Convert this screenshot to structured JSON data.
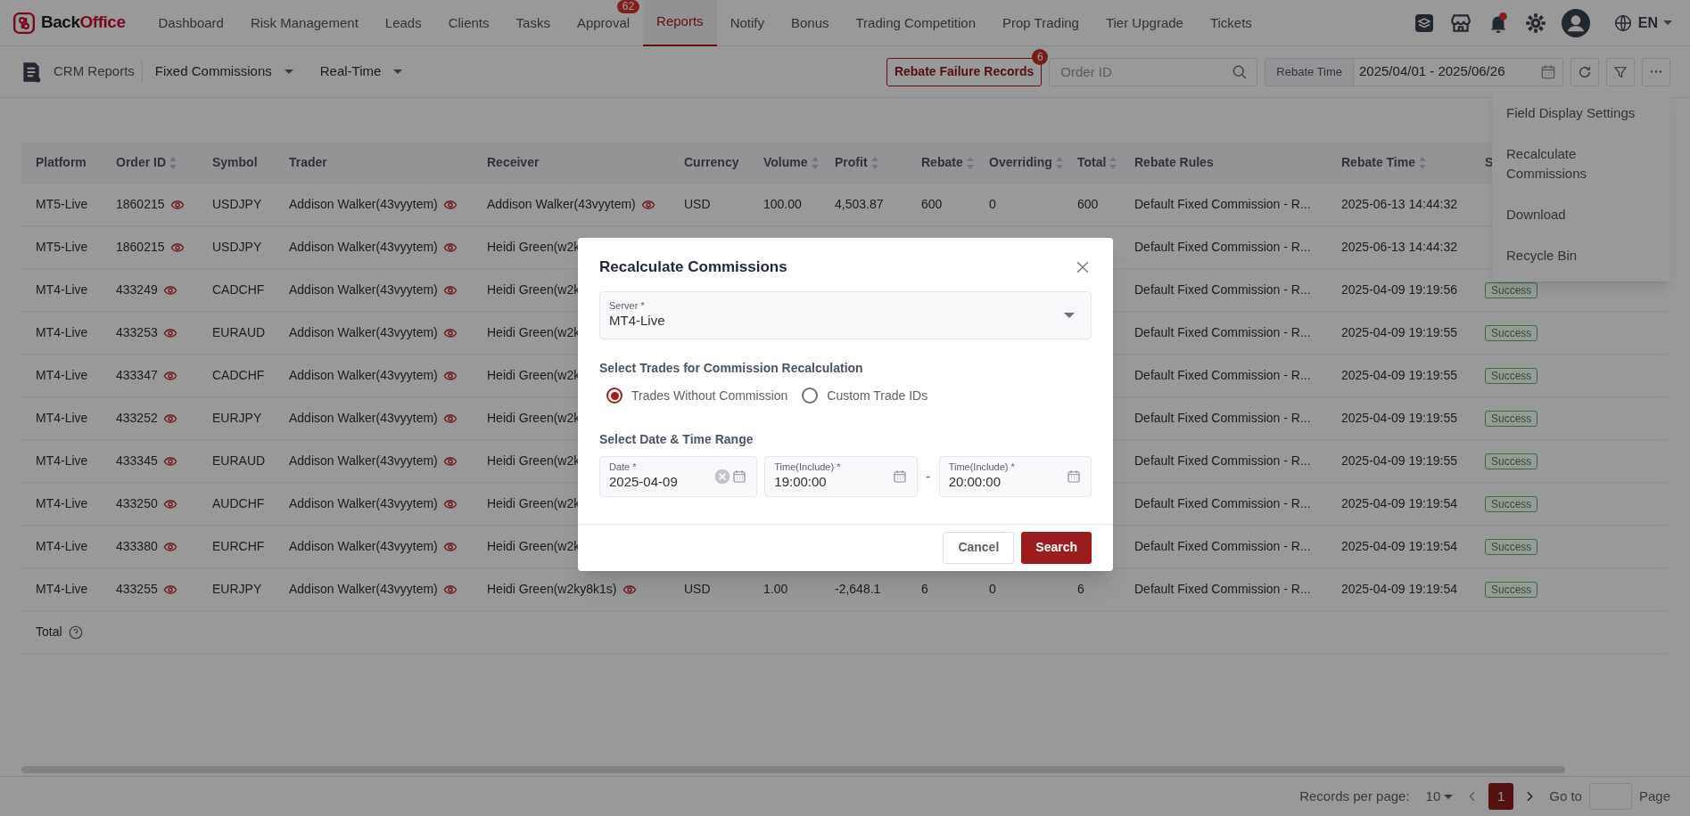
{
  "nav": {
    "logo": {
      "dark": "Back",
      "accent": "Office"
    },
    "items": [
      {
        "label": "Dashboard",
        "selected": false
      },
      {
        "label": "Risk Management",
        "selected": false
      },
      {
        "label": "Leads",
        "selected": false
      },
      {
        "label": "Clients",
        "selected": false
      },
      {
        "label": "Tasks",
        "selected": false
      },
      {
        "label": "Approval",
        "selected": false,
        "badge": "62"
      },
      {
        "label": "Reports",
        "selected": true
      },
      {
        "label": "Notify",
        "selected": false
      },
      {
        "label": "Bonus",
        "selected": false
      },
      {
        "label": "Trading Competition",
        "selected": false
      },
      {
        "label": "Prop Trading",
        "selected": false
      },
      {
        "label": "Tier Upgrade",
        "selected": false
      },
      {
        "label": "Tickets",
        "selected": false
      }
    ],
    "language": "EN"
  },
  "toolbar": {
    "title": "CRM Reports",
    "dropdowns": [
      "Fixed Commissions",
      "Real-Time"
    ],
    "failure_button": {
      "label": "Rebate Failure Records",
      "badge": "6"
    },
    "search": {
      "placeholder": "Order ID"
    },
    "date_filter": {
      "label": "Rebate Time",
      "value": "2025/04/01 - 2025/06/26"
    }
  },
  "menu": {
    "items": [
      "Field Display Settings",
      "Recalculate Commissions",
      "Download",
      "Recycle Bin"
    ]
  },
  "table": {
    "columns": [
      {
        "label": "Platform",
        "sortable": false
      },
      {
        "label": "Order ID",
        "sortable": true
      },
      {
        "label": "Symbol",
        "sortable": false
      },
      {
        "label": "Trader",
        "sortable": false
      },
      {
        "label": "Receiver",
        "sortable": false
      },
      {
        "label": "Currency",
        "sortable": false
      },
      {
        "label": "Volume",
        "sortable": true
      },
      {
        "label": "Profit",
        "sortable": true
      },
      {
        "label": "Rebate",
        "sortable": true
      },
      {
        "label": "Overriding",
        "sortable": true
      },
      {
        "label": "Total",
        "sortable": true
      },
      {
        "label": "Rebate Rules",
        "sortable": false
      },
      {
        "label": "Rebate Time",
        "sortable": true
      },
      {
        "label": "S",
        "sortable": false
      }
    ],
    "rows": [
      {
        "platform": "MT5-Live",
        "order_id": "1860215",
        "symbol": "USDJPY",
        "trader": "Addison Walker(43vyytem)",
        "receiver": "Addison Walker(43vyytem)",
        "currency": "USD",
        "volume": "100.00",
        "profit": "4,503.87",
        "rebate": "600",
        "overriding": "0",
        "total": "600",
        "rebate_rule": "Default Fixed Commission - R...",
        "rebate_time": "2025-06-13 14:44:32"
      },
      {
        "platform": "MT5-Live",
        "order_id": "1860215",
        "symbol": "USDJPY",
        "trader": "Addison Walker(43vyytem)",
        "receiver": "Heidi Green(w2k",
        "rebate_rule": "Default Fixed Commission - R...",
        "rebate_time": "2025-06-13 14:44:32"
      },
      {
        "platform": "MT4-Live",
        "order_id": "433249",
        "symbol": "CADCHF",
        "trader": "Addison Walker(43vyytem)",
        "receiver": "Heidi Green(w2k",
        "rebate_rule": "Default Fixed Commission - R...",
        "rebate_time": "2025-04-09 19:19:56",
        "status": "Success"
      },
      {
        "platform": "MT4-Live",
        "order_id": "433253",
        "symbol": "EURAUD",
        "trader": "Addison Walker(43vyytem)",
        "receiver": "Heidi Green(w2k",
        "rebate_rule": "Default Fixed Commission - R...",
        "rebate_time": "2025-04-09 19:19:55",
        "status": "Success"
      },
      {
        "platform": "MT4-Live",
        "order_id": "433347",
        "symbol": "CADCHF",
        "trader": "Addison Walker(43vyytem)",
        "receiver": "Heidi Green(w2k",
        "rebate_rule": "Default Fixed Commission - R...",
        "rebate_time": "2025-04-09 19:19:55",
        "status": "Success"
      },
      {
        "platform": "MT4-Live",
        "order_id": "433252",
        "symbol": "EURJPY",
        "trader": "Addison Walker(43vyytem)",
        "receiver": "Heidi Green(w2k",
        "rebate_rule": "Default Fixed Commission - R...",
        "rebate_time": "2025-04-09 19:19:55",
        "status": "Success"
      },
      {
        "platform": "MT4-Live",
        "order_id": "433345",
        "symbol": "EURAUD",
        "trader": "Addison Walker(43vyytem)",
        "receiver": "Heidi Green(w2k",
        "rebate_rule": "Default Fixed Commission - R...",
        "rebate_time": "2025-04-09 19:19:55",
        "status": "Success"
      },
      {
        "platform": "MT4-Live",
        "order_id": "433250",
        "symbol": "AUDCHF",
        "trader": "Addison Walker(43vyytem)",
        "receiver": "Heidi Green(w2k",
        "rebate_rule": "Default Fixed Commission - R...",
        "rebate_time": "2025-04-09 19:19:54",
        "status": "Success"
      },
      {
        "platform": "MT4-Live",
        "order_id": "433380",
        "symbol": "EURCHF",
        "trader": "Addison Walker(43vyytem)",
        "receiver": "Heidi Green(w2k",
        "rebate_rule": "Default Fixed Commission - R...",
        "rebate_time": "2025-04-09 19:19:54",
        "status": "Success"
      },
      {
        "platform": "MT4-Live",
        "order_id": "433255",
        "symbol": "EURJPY",
        "trader": "Addison Walker(43vyytem)",
        "receiver": "Heidi Green(w2ky8k1s)",
        "currency": "USD",
        "volume": "1.00",
        "profit": "-2,648.1",
        "rebate": "6",
        "overriding": "0",
        "total": "6",
        "rebate_rule": "Default Fixed Commission - R...",
        "rebate_time": "2025-04-09 19:19:54",
        "status": "Success"
      }
    ],
    "footer": "Total"
  },
  "pagination": {
    "label": "Records per page:",
    "per_page": "10",
    "pages": [
      {
        "label": "1",
        "selected": true
      }
    ],
    "goto": "Go to",
    "page_suffix": "Page"
  },
  "dialog": {
    "title": "Recalculate Commissions",
    "server": {
      "label": "Server *",
      "value": "MT4-Live"
    },
    "trades_heading": "Select Trades for Commission Recalculation",
    "options": [
      {
        "label": "Trades Without Commission",
        "selected": true
      },
      {
        "label": "Custom Trade IDs",
        "selected": false
      }
    ],
    "range_heading": "Select Date & Time Range",
    "date": {
      "label": "Date *",
      "value": "2025-04-09"
    },
    "time_from": {
      "label": "Time(Include) *",
      "value": "19:00:00"
    },
    "range_separator": "-",
    "time_to": {
      "label": "Time(Include) *",
      "value": "20:00:00"
    },
    "cancel": "Cancel",
    "confirm": "Search"
  }
}
